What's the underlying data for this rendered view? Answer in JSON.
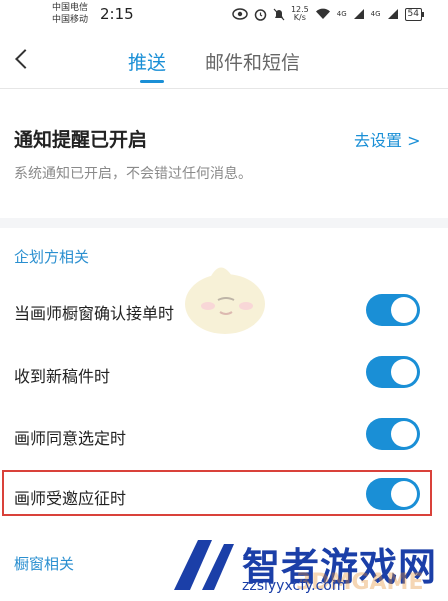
{
  "status_bar": {
    "carrier1": "中国电信",
    "carrier2": "中国移动",
    "time": "2:15",
    "net_speed_value": "12.5",
    "net_speed_unit": "K/s",
    "signal1": "4G",
    "signal2": "4G",
    "battery": "54"
  },
  "tabs": [
    {
      "label": "推送",
      "active": true
    },
    {
      "label": "邮件和短信",
      "active": false
    }
  ],
  "notice": {
    "title": "通知提醒已开启",
    "desc": "系统通知已开启，不会错过任何消息。",
    "settings_link": "去设置 >"
  },
  "sections": {
    "planner": "企划方相关",
    "window": "橱窗相关"
  },
  "items": [
    {
      "label": "当画师橱窗确认接单时",
      "on": true
    },
    {
      "label": "收到新稿件时",
      "on": true
    },
    {
      "label": "画师同意选定时",
      "on": true
    },
    {
      "label": "画师受邀应征时",
      "on": true
    }
  ],
  "watermark": {
    "brand": "智者游戏网",
    "url": "zzslyyxcfy.com",
    "ghost": "3DMGAME"
  },
  "colors": {
    "accent": "#1a8fd6",
    "highlight_border": "#d9413a"
  }
}
